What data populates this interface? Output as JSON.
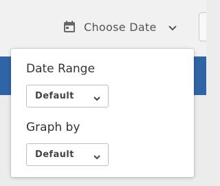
{
  "toolbar": {
    "date_picker_label": "Choose Date",
    "calendar_icon": "calendar-icon",
    "chevron_icon": "chevron-down-icon"
  },
  "colors": {
    "accent_band": "#2f64a7",
    "text": "#333333",
    "muted_text": "#555555"
  },
  "popover": {
    "date_range": {
      "label": "Date Range",
      "selected": "Default"
    },
    "graph_by": {
      "label": "Graph by",
      "selected": "Default"
    }
  }
}
